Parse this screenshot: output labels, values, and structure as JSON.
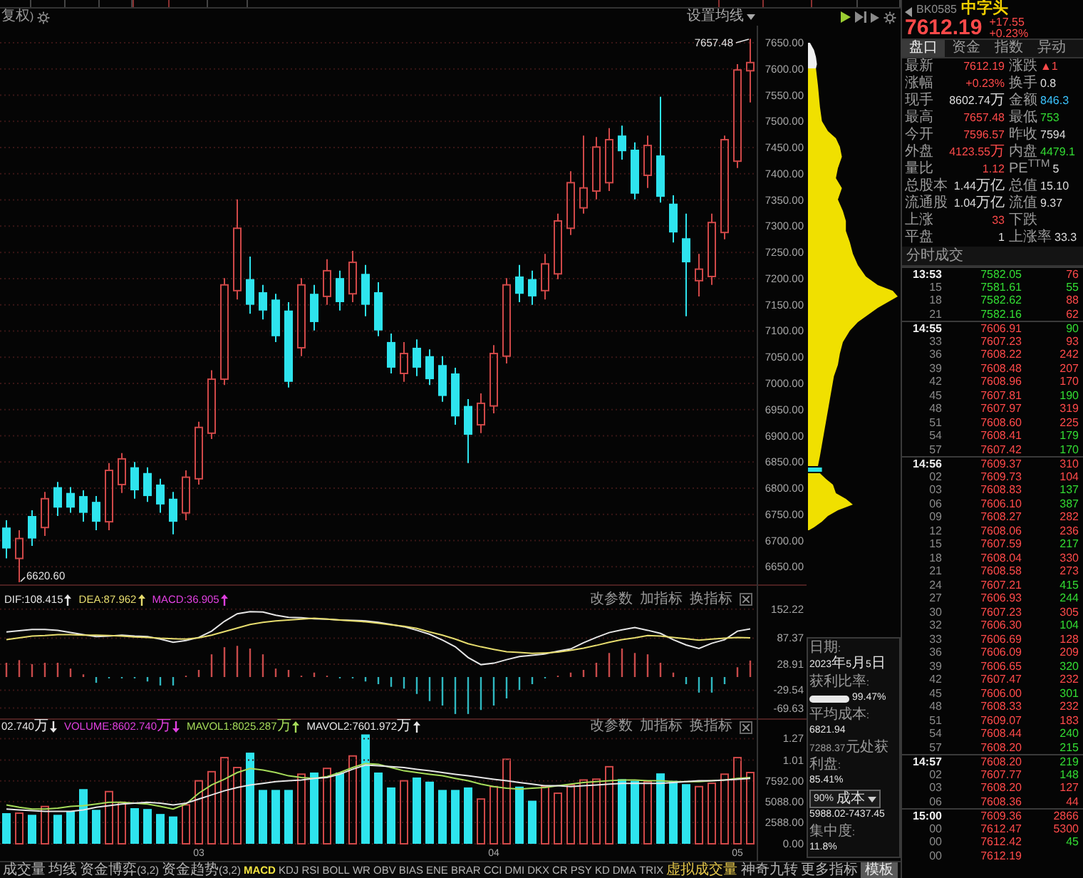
{
  "chart_header": {
    "left_label": "复权)",
    "ma_button": "设置均线"
  },
  "price_chart": {
    "high_label": "7657.48",
    "low_label": "6620.60",
    "chart_data": {
      "type": "candlestick",
      "grid": true,
      "ylim": [
        6616.5,
        7682.6
      ],
      "yticks": [
        {
          "value": 7650,
          "label": "7650.00"
        },
        {
          "value": 7600,
          "label": "7600.00"
        },
        {
          "value": 7550,
          "label": "7550.00"
        },
        {
          "value": 7500,
          "label": "7500.00"
        },
        {
          "value": 7450,
          "label": "7450.00"
        },
        {
          "value": 7400,
          "label": "7400.00"
        },
        {
          "value": 7350,
          "label": "7350.00"
        },
        {
          "value": 7300,
          "label": "7300.00"
        },
        {
          "value": 7250,
          "label": "7250.00"
        },
        {
          "value": 7200,
          "label": "7200.00"
        },
        {
          "value": 7150,
          "label": "7150.00"
        },
        {
          "value": 7100,
          "label": "7100.00"
        },
        {
          "value": 7050,
          "label": "7050.00"
        },
        {
          "value": 7000,
          "label": "7000.00"
        },
        {
          "value": 6950,
          "label": "6950.00"
        },
        {
          "value": 6900,
          "label": "6900.00"
        },
        {
          "value": 6850,
          "label": "6850.00"
        },
        {
          "value": 6800,
          "label": "6800.00"
        },
        {
          "value": 6750,
          "label": "6750.00"
        },
        {
          "value": 6700,
          "label": "6700.00"
        },
        {
          "value": 6650,
          "label": "6650.00"
        }
      ],
      "categories": [
        null,
        null,
        null,
        null,
        null,
        null,
        null,
        null,
        null,
        null,
        null,
        null,
        null,
        null,
        null,
        null,
        null,
        null,
        null,
        null,
        null,
        null,
        null,
        null,
        null,
        null,
        null,
        null,
        null,
        null,
        null,
        null,
        null,
        null,
        null,
        null,
        null,
        null,
        null,
        null,
        null,
        null,
        null,
        null,
        null,
        null,
        null,
        null,
        null,
        null,
        null,
        null,
        null,
        null,
        null,
        null,
        null,
        null,
        null
      ],
      "ohlc": [
        [
          6725,
          6739,
          6666,
          6685
        ],
        [
          6666,
          6720,
          6620.6,
          6704
        ],
        [
          6747,
          6758,
          6690,
          6704
        ],
        [
          6725,
          6793,
          6709,
          6780
        ],
        [
          6802,
          6812,
          6747,
          6763
        ],
        [
          6791,
          6802,
          6753,
          6763
        ],
        [
          6785,
          6796,
          6736,
          6753
        ],
        [
          6774,
          6785,
          6720,
          6736
        ],
        [
          6736,
          6848,
          6720,
          6834
        ],
        [
          6807,
          6867,
          6791,
          6856
        ],
        [
          6840,
          6850,
          6780,
          6796
        ],
        [
          6829,
          6840,
          6774,
          6785
        ],
        [
          6807,
          6818,
          6753,
          6769
        ],
        [
          6780,
          6793,
          6712,
          6736
        ],
        [
          6753,
          6834,
          6739,
          6821
        ],
        [
          6818,
          6927,
          6807,
          6916
        ],
        [
          6905,
          7025,
          6894,
          7008
        ],
        [
          7008,
          7201,
          6997,
          7188
        ],
        [
          7177,
          7351,
          7160,
          7296
        ],
        [
          7199,
          7242,
          7133,
          7150
        ],
        [
          7174,
          7188,
          7122,
          7139
        ],
        [
          7160,
          7171,
          7079,
          7090
        ],
        [
          7139,
          7155,
          6992,
          7003
        ],
        [
          7068,
          7201,
          7052,
          7188
        ],
        [
          7171,
          7188,
          7101,
          7117
        ],
        [
          7166,
          7237,
          7150,
          7215
        ],
        [
          7201,
          7215,
          7139,
          7155
        ],
        [
          7171,
          7253,
          7155,
          7231
        ],
        [
          7209,
          7226,
          7128,
          7150
        ],
        [
          7174,
          7193,
          7090,
          7101
        ],
        [
          7079,
          7095,
          7019,
          7030
        ],
        [
          7019,
          7079,
          7003,
          7057
        ],
        [
          7068,
          7084,
          7014,
          7030
        ],
        [
          7052,
          7065,
          6997,
          7008
        ],
        [
          7035,
          7052,
          6965,
          6976
        ],
        [
          7019,
          7030,
          6921,
          6937
        ],
        [
          6957,
          6970,
          6848,
          6902
        ],
        [
          6921,
          6981,
          6905,
          6962
        ],
        [
          6957,
          7073,
          6943,
          7057
        ],
        [
          7052,
          7201,
          7038,
          7188
        ],
        [
          7204,
          7226,
          7155,
          7171
        ],
        [
          7199,
          7215,
          7150,
          7166
        ],
        [
          7177,
          7247,
          7160,
          7228
        ],
        [
          7209,
          7324,
          7199,
          7310
        ],
        [
          7296,
          7405,
          7283,
          7383
        ],
        [
          7335,
          7473,
          7324,
          7373
        ],
        [
          7367,
          7470,
          7351,
          7451
        ],
        [
          7383,
          7487,
          7367,
          7465
        ],
        [
          7473,
          7492,
          7427,
          7443
        ],
        [
          7446,
          7460,
          7351,
          7362
        ],
        [
          7397,
          7473,
          7373,
          7454
        ],
        [
          7435,
          7547,
          7345,
          7356
        ],
        [
          7343,
          7359,
          7269,
          7288
        ],
        [
          7277,
          7324,
          7128,
          7231
        ],
        [
          7196,
          7247,
          7166,
          7218
        ],
        [
          7204,
          7324,
          7188,
          7307
        ],
        [
          7288,
          7473,
          7275,
          7465
        ],
        [
          7424,
          7609,
          7411,
          7598
        ],
        [
          7596.57,
          7657.48,
          7536,
          7612.19
        ]
      ]
    }
  },
  "macd_panel": {
    "readouts": [
      {
        "text": "DIF:108.415",
        "rising": true,
        "color": "#e6e6e6"
      },
      {
        "text": "DEA:87.962",
        "rising": true,
        "color": "#e6dc6e"
      },
      {
        "text": "MACD:36.905",
        "rising": true,
        "color": "#e040e0"
      }
    ],
    "buttons": [
      "改参数",
      "加指标",
      "换指标"
    ],
    "chart_data": {
      "type": "line",
      "grid": true,
      "ylim": [
        -92.8,
        208
      ],
      "yticks": [
        152.22,
        87.37,
        28.91,
        -29.54,
        -69.63
      ],
      "categories": [
        null,
        null,
        null,
        null,
        null,
        null,
        null,
        null,
        null,
        null,
        null,
        null,
        null,
        null,
        null,
        null,
        null,
        null,
        null,
        null,
        null,
        null,
        null,
        null,
        null,
        null,
        null,
        null,
        null,
        null,
        null,
        null,
        null,
        null,
        null,
        null,
        null,
        null,
        null,
        null,
        null,
        null,
        null,
        null,
        null,
        null,
        null,
        null,
        null,
        null,
        null,
        null,
        null,
        null,
        null,
        null,
        null,
        null,
        null
      ],
      "series": [
        {
          "type": "bar",
          "values": [
            32,
            38,
            29,
            32,
            32,
            19,
            6,
            -13,
            -3,
            -3,
            -3,
            -10,
            -19,
            -19,
            3,
            16,
            51,
            67,
            70,
            64,
            51,
            19,
            16,
            3,
            10,
            3,
            -3,
            -3,
            -10,
            -16,
            -22,
            -26,
            -38,
            -54,
            -64,
            -83,
            -83,
            -74,
            -64,
            -48,
            -29,
            -16,
            -3,
            3,
            10,
            16,
            32,
            54,
            64,
            54,
            51,
            32,
            10,
            -16,
            -35,
            -35,
            -16,
            22,
            37
          ],
          "colors": [
            "#c84a4a",
            "#c84a4a",
            "#c84a4a",
            "#c84a4a",
            "#c84a4a",
            "#c84a4a",
            "#c84a4a",
            "#2fb8c0",
            "#2fb8c0",
            "#2fb8c0",
            "#2fb8c0",
            "#2fb8c0",
            "#2fb8c0",
            "#2fb8c0",
            "#c84a4a",
            "#c84a4a",
            "#c84a4a",
            "#c84a4a",
            "#c84a4a",
            "#c84a4a",
            "#c84a4a",
            "#c84a4a",
            "#c84a4a",
            "#c84a4a",
            "#c84a4a",
            "#c84a4a",
            "#2fb8c0",
            "#2fb8c0",
            "#2fb8c0",
            "#2fb8c0",
            "#2fb8c0",
            "#2fb8c0",
            "#2fb8c0",
            "#2fb8c0",
            "#2fb8c0",
            "#2fb8c0",
            "#2fb8c0",
            "#2fb8c0",
            "#2fb8c0",
            "#2fb8c0",
            "#2fb8c0",
            "#2fb8c0",
            "#2fb8c0",
            "#c84a4a",
            "#c84a4a",
            "#c84a4a",
            "#c84a4a",
            "#c84a4a",
            "#c84a4a",
            "#c84a4a",
            "#c84a4a",
            "#c84a4a",
            "#c84a4a",
            "#2fb8c0",
            "#2fb8c0",
            "#2fb8c0",
            "#2fb8c0",
            "#c84a4a",
            "#c84a4a"
          ]
        },
        {
          "color": "#e6e6e6",
          "values": [
            101,
            104,
            107,
            107,
            105,
            100,
            95,
            91,
            92,
            94,
            92,
            91,
            85,
            78,
            82,
            89,
            103,
            125,
            142,
            147,
            146,
            139,
            134,
            133,
            131,
            130,
            128,
            127,
            126,
            123,
            118,
            113,
            105,
            96,
            83,
            68,
            44,
            28,
            31,
            39,
            46,
            49,
            52,
            58,
            63,
            77,
            89,
            100,
            106,
            111,
            105,
            98,
            84,
            72,
            64,
            76,
            84,
            103,
            108
          ]
        },
        {
          "color": "#e6dc6e",
          "values": [
            84,
            88,
            92,
            93,
            95,
            95,
            94,
            94,
            93,
            92,
            90,
            89,
            87,
            86,
            85,
            88,
            94,
            102,
            110,
            118,
            123,
            126,
            128,
            130,
            132,
            130,
            128,
            126,
            124,
            121,
            117,
            114,
            109,
            101,
            94,
            85,
            75,
            68,
            62,
            57,
            55,
            53,
            54,
            56,
            60,
            65,
            71,
            78,
            84,
            88,
            93,
            92,
            89,
            86,
            83,
            85,
            87,
            89,
            88
          ]
        }
      ]
    }
  },
  "volume_panel": {
    "readouts": [
      {
        "text": "02.740万",
        "rising": false,
        "color": "#e6e6e6"
      },
      {
        "text": "VOLUME:8602.740万",
        "rising": false,
        "color": "#e040e0"
      },
      {
        "text": "MAVOL1:8025.287万",
        "rising": true,
        "color": "#a6dc5a"
      },
      {
        "text": "MAVOL2:7601.972万",
        "rising": true,
        "color": "#e6e6e6"
      }
    ],
    "buttons": [
      "改参数",
      "加指标",
      "换指标"
    ],
    "upper_axis_labels": [
      "1.27",
      "1.01"
    ],
    "chart_data": {
      "type": "bar",
      "grid": true,
      "ylim": [
        -2064,
        15136
      ],
      "yticks": [
        {
          "value": 7592,
          "label": "7592.00"
        },
        {
          "value": 5088,
          "label": "5088.00"
        },
        {
          "value": 2588,
          "label": "2588.00"
        },
        {
          "value": 0,
          "label": "0.00"
        }
      ],
      "categories": [
        null,
        null,
        null,
        null,
        null,
        null,
        null,
        null,
        null,
        null,
        null,
        null,
        null,
        null,
        null,
        "03",
        null,
        null,
        null,
        null,
        null,
        null,
        null,
        null,
        null,
        null,
        null,
        null,
        null,
        null,
        null,
        null,
        null,
        null,
        null,
        null,
        null,
        null,
        "04",
        null,
        null,
        null,
        null,
        null,
        null,
        null,
        null,
        null,
        null,
        null,
        null,
        null,
        null,
        null,
        null,
        null,
        null,
        "05",
        null
      ],
      "series": [
        {
          "values": [
            3700,
            3700,
            3500,
            4500,
            3500,
            3900,
            6600,
            4100,
            6300,
            5000,
            4300,
            4200,
            3600,
            3300,
            4700,
            7600,
            8700,
            10400,
            9200,
            11000,
            6500,
            6500,
            6500,
            8400,
            8600,
            9100,
            8600,
            10600,
            13200,
            8600,
            6800,
            7600,
            8000,
            7500,
            6500,
            6500,
            6800,
            5400,
            6900,
            10200,
            6900,
            5200,
            6900,
            6100,
            7100,
            7700,
            7800,
            9300,
            7800,
            7600,
            7500,
            8500,
            7600,
            7200,
            6900,
            7300,
            8400,
            10400,
            8600
          ],
          "colors": [
            "#2ee4ee",
            "#d04848",
            "#2ee4ee",
            "#d04848",
            "#2ee4ee",
            "#2ee4ee",
            "#2ee4ee",
            "#2ee4ee",
            "#d04848",
            "#d04848",
            "#2ee4ee",
            "#2ee4ee",
            "#2ee4ee",
            "#2ee4ee",
            "#d04848",
            "#d04848",
            "#d04848",
            "#d04848",
            "#d04848",
            "#2ee4ee",
            "#2ee4ee",
            "#2ee4ee",
            "#2ee4ee",
            "#d04848",
            "#2ee4ee",
            "#d04848",
            "#2ee4ee",
            "#d04848",
            "#2ee4ee",
            "#2ee4ee",
            "#2ee4ee",
            "#d04848",
            "#2ee4ee",
            "#2ee4ee",
            "#2ee4ee",
            "#2ee4ee",
            "#2ee4ee",
            "#d04848",
            "#d04848",
            "#d04848",
            "#2ee4ee",
            "#2ee4ee",
            "#d04848",
            "#d04848",
            "#d04848",
            "#d04848",
            "#d04848",
            "#d04848",
            "#2ee4ee",
            "#2ee4ee",
            "#d04848",
            "#2ee4ee",
            "#2ee4ee",
            "#2ee4ee",
            "#d04848",
            "#d04848",
            "#d04848",
            "#d04848",
            "#d04848"
          ]
        },
        {
          "type": "line",
          "color": "#a6dc5a",
          "values": [
            4700,
            4400,
            4200,
            4200,
            4300,
            4500,
            4600,
            4800,
            5000,
            5000,
            4900,
            4800,
            4500,
            4200,
            4800,
            6100,
            7100,
            7800,
            8600,
            9100,
            8900,
            8600,
            8200,
            8000,
            7900,
            8100,
            8600,
            9200,
            9700,
            9600,
            9200,
            8800,
            8600,
            8400,
            8200,
            7900,
            7600,
            7200,
            6900,
            6700,
            6600,
            6700,
            6800,
            7000,
            7200,
            7400,
            7500,
            7600,
            7700,
            7700,
            7600,
            7600,
            7500,
            7500,
            7500,
            7600,
            7700,
            7900,
            8000
          ]
        },
        {
          "type": "line",
          "color": "#e6e6e6",
          "values": [
            4200,
            4100,
            4000,
            3900,
            3900,
            3900,
            4100,
            4400,
            4600,
            4800,
            4900,
            5000,
            4900,
            4700,
            4900,
            5400,
            5900,
            6400,
            6800,
            7100,
            7300,
            7500,
            7600,
            7700,
            7900,
            8000,
            8400,
            9000,
            9500,
            9400,
            9300,
            9200,
            9000,
            8800,
            8600,
            8400,
            8200,
            8000,
            7800,
            7600,
            7400,
            7200,
            7000,
            7000,
            6900,
            7000,
            7100,
            7200,
            7300,
            7300,
            7300,
            7300,
            7400,
            7500,
            7600,
            7600,
            7700,
            7800,
            7900
          ]
        }
      ]
    }
  },
  "profile_info": {
    "rows": [
      {
        "kind": "text",
        "label": "日期:",
        "value": "2023年5月5日"
      },
      {
        "kind": "meter",
        "label": "获利比率:",
        "level": 0.9947,
        "value": "99.47%"
      },
      {
        "kind": "text",
        "label": "平均成本:",
        "value": "6821.94"
      },
      {
        "kind": "text",
        "label": "7288.37元处获利盘:",
        "value": "85.41%"
      },
      {
        "kind": "select",
        "label": "90%成本",
        "value": "5988.02-7437.45"
      },
      {
        "kind": "text",
        "label": "集中度:",
        "value": "11.8%"
      }
    ]
  },
  "indicator_tabs": [
    {
      "label": "成交量",
      "kind": "indicator",
      "selected": false
    },
    {
      "label": "均线",
      "kind": "indicator",
      "selected": false
    },
    {
      "label": "资金博弈(3,2)",
      "kind": "indicator",
      "selected": false
    },
    {
      "label": "资金趋势(3,2)",
      "kind": "indicator",
      "selected": false
    },
    {
      "label": "MACD",
      "kind": "indicator",
      "selected": true
    },
    {
      "label": "KDJ",
      "kind": "indicator",
      "selected": false
    },
    {
      "label": "RSI",
      "kind": "indicator",
      "selected": false
    },
    {
      "label": "BOLL",
      "kind": "indicator",
      "selected": false
    },
    {
      "label": "WR",
      "kind": "indicator",
      "selected": false
    },
    {
      "label": "OBV",
      "kind": "indicator",
      "selected": false
    },
    {
      "label": "BIAS",
      "kind": "indicator",
      "selected": false
    },
    {
      "label": "ENE",
      "kind": "indicator",
      "selected": false
    },
    {
      "label": "BRAR",
      "kind": "indicator",
      "selected": false
    },
    {
      "label": "CCI",
      "kind": "indicator",
      "selected": false
    },
    {
      "label": "DMI",
      "kind": "indicator",
      "selected": false
    },
    {
      "label": "DKX",
      "kind": "indicator",
      "selected": false
    },
    {
      "label": "CR",
      "kind": "indicator",
      "selected": false
    },
    {
      "label": "PSY",
      "kind": "indicator",
      "selected": false
    },
    {
      "label": "KD",
      "kind": "indicator",
      "selected": false
    },
    {
      "label": "DMA",
      "kind": "indicator",
      "selected": false
    },
    {
      "label": "TRIX",
      "kind": "indicator",
      "selected": false
    },
    {
      "label": "虚拟成交量",
      "kind": "featured",
      "selected": false
    },
    {
      "label": "神奇九转",
      "kind": "indicator",
      "selected": false
    },
    {
      "label": "更多指标",
      "kind": "indicator",
      "selected": false
    },
    {
      "label": "模板",
      "kind": "button",
      "selected": false
    }
  ],
  "quote_panel": {
    "header": {
      "code": "BK0585",
      "name": "中字头",
      "price": "7612.19",
      "change": "+17.55",
      "change_pct": "+0.23%",
      "rising": true
    },
    "tabs": [
      {
        "label": "盘口",
        "selected": true
      },
      {
        "label": "资金",
        "selected": false
      },
      {
        "label": "指数",
        "selected": false
      },
      {
        "label": "异动",
        "selected": false
      }
    ],
    "rows": [
      [
        {
          "label": "最新",
          "value": "7612.19",
          "color": "#ff4a4a"
        },
        {
          "label": "涨跌",
          "value": "▲1",
          "color": "#ff4a4a"
        }
      ],
      [
        {
          "label": "涨幅",
          "value": "+0.23%",
          "color": "#ff4a4a"
        },
        {
          "label": "换手",
          "value": "0.8",
          "color": "#dedede"
        }
      ],
      [
        {
          "label": "现手",
          "value": "8602.74万",
          "color": "#dedede"
        },
        {
          "label": "金额",
          "value": "846.3",
          "color": "#3cc4ff"
        }
      ],
      [
        {
          "label": "最高",
          "value": "7657.48",
          "color": "#ff4a4a"
        },
        {
          "label": "最低",
          "value": "753",
          "color": "#33dd33"
        }
      ],
      [
        {
          "label": "今开",
          "value": "7596.57",
          "color": "#ff4a4a"
        },
        {
          "label": "昨收",
          "value": "7594",
          "color": "#dedede"
        }
      ],
      [
        {
          "label": "外盘",
          "value": "4123.55万",
          "color": "#ff4a4a"
        },
        {
          "label": "内盘",
          "value": "4479.1",
          "color": "#33dd33"
        }
      ],
      [
        {
          "label": "量比",
          "value": "1.12",
          "color": "#ff4a4a"
        },
        {
          "label": "PE$^{TTM}$",
          "value": "5",
          "color": "#dedede"
        }
      ],
      [
        {
          "label": "总股本",
          "value": "1.44万亿",
          "color": "#dedede"
        },
        {
          "label": "总值",
          "value": "15.10",
          "color": "#dedede"
        }
      ],
      [
        {
          "label": "流通股",
          "value": "1.04万亿",
          "color": "#dedede"
        },
        {
          "label": "流值",
          "value": "9.37",
          "color": "#dedede"
        }
      ],
      [
        {
          "label": "上涨",
          "value": "33",
          "color": "#ff4a4a"
        },
        {
          "label": "下跌"
        }
      ],
      [
        {
          "label": "平盘",
          "value": "1",
          "color": "#dedede"
        },
        {
          "label": "上涨率",
          "value": "33.3",
          "color": "#dedede"
        }
      ]
    ],
    "trades_title": "分时成交",
    "trade_groups": [
      {
        "rows": [
          {
            "time": "13:53",
            "price": {
              "text": "7582.05",
              "color": "#33dd33"
            },
            "volume": {
              "text": "76",
              "color": "#ff4a4a"
            }
          },
          {
            "time": "15",
            "price": {
              "text": "7581.61",
              "color": "#33dd33"
            },
            "volume": {
              "text": "55",
              "color": "#33dd33"
            }
          },
          {
            "time": "18",
            "price": {
              "text": "7582.62",
              "color": "#33dd33"
            },
            "volume": {
              "text": "88",
              "color": "#ff4a4a"
            }
          },
          {
            "time": "21",
            "price": {
              "text": "7582.16",
              "color": "#33dd33"
            },
            "volume": {
              "text": "62",
              "color": "#ff4a4a"
            }
          }
        ]
      },
      {
        "rows": [
          {
            "time": "14:55",
            "price": {
              "text": "7606.91",
              "color": "#ff4a4a"
            },
            "volume": {
              "text": "90",
              "color": "#33dd33"
            }
          },
          {
            "time": "33",
            "price": {
              "text": "7607.23",
              "color": "#ff4a4a"
            },
            "volume": {
              "text": "93",
              "color": "#ff4a4a"
            }
          },
          {
            "time": "36",
            "price": {
              "text": "7608.22",
              "color": "#ff4a4a"
            },
            "volume": {
              "text": "242",
              "color": "#ff4a4a"
            }
          },
          {
            "time": "39",
            "price": {
              "text": "7608.48",
              "color": "#ff4a4a"
            },
            "volume": {
              "text": "207",
              "color": "#ff4a4a"
            }
          },
          {
            "time": "42",
            "price": {
              "text": "7608.96",
              "color": "#ff4a4a"
            },
            "volume": {
              "text": "170",
              "color": "#ff4a4a"
            }
          },
          {
            "time": "45",
            "price": {
              "text": "7607.81",
              "color": "#ff4a4a"
            },
            "volume": {
              "text": "190",
              "color": "#33dd33"
            }
          },
          {
            "time": "48",
            "price": {
              "text": "7607.97",
              "color": "#ff4a4a"
            },
            "volume": {
              "text": "319",
              "color": "#ff4a4a"
            }
          },
          {
            "time": "51",
            "price": {
              "text": "7608.60",
              "color": "#ff4a4a"
            },
            "volume": {
              "text": "225",
              "color": "#ff4a4a"
            }
          },
          {
            "time": "54",
            "price": {
              "text": "7608.41",
              "color": "#ff4a4a"
            },
            "volume": {
              "text": "179",
              "color": "#33dd33"
            }
          },
          {
            "time": "57",
            "price": {
              "text": "7607.42",
              "color": "#ff4a4a"
            },
            "volume": {
              "text": "170",
              "color": "#33dd33"
            }
          }
        ]
      },
      {
        "rows": [
          {
            "time": "14:56",
            "price": {
              "text": "7609.37",
              "color": "#ff4a4a"
            },
            "volume": {
              "text": "310",
              "color": "#ff4a4a"
            }
          },
          {
            "time": "02",
            "price": {
              "text": "7609.73",
              "color": "#ff4a4a"
            },
            "volume": {
              "text": "104",
              "color": "#ff4a4a"
            }
          },
          {
            "time": "03",
            "price": {
              "text": "7608.83",
              "color": "#ff4a4a"
            },
            "volume": {
              "text": "137",
              "color": "#33dd33"
            }
          },
          {
            "time": "06",
            "price": {
              "text": "7606.10",
              "color": "#ff4a4a"
            },
            "volume": {
              "text": "387",
              "color": "#33dd33"
            }
          },
          {
            "time": "09",
            "price": {
              "text": "7608.27",
              "color": "#ff4a4a"
            },
            "volume": {
              "text": "282",
              "color": "#ff4a4a"
            }
          },
          {
            "time": "12",
            "price": {
              "text": "7608.06",
              "color": "#ff4a4a"
            },
            "volume": {
              "text": "236",
              "color": "#ff4a4a"
            }
          },
          {
            "time": "15",
            "price": {
              "text": "7607.59",
              "color": "#ff4a4a"
            },
            "volume": {
              "text": "217",
              "color": "#33dd33"
            }
          },
          {
            "time": "18",
            "price": {
              "text": "7608.04",
              "color": "#ff4a4a"
            },
            "volume": {
              "text": "330",
              "color": "#ff4a4a"
            }
          },
          {
            "time": "21",
            "price": {
              "text": "7608.58",
              "color": "#ff4a4a"
            },
            "volume": {
              "text": "273",
              "color": "#ff4a4a"
            }
          },
          {
            "time": "24",
            "price": {
              "text": "7607.21",
              "color": "#ff4a4a"
            },
            "volume": {
              "text": "415",
              "color": "#33dd33"
            }
          },
          {
            "time": "27",
            "price": {
              "text": "7606.93",
              "color": "#ff4a4a"
            },
            "volume": {
              "text": "244",
              "color": "#33dd33"
            }
          },
          {
            "time": "30",
            "price": {
              "text": "7607.23",
              "color": "#ff4a4a"
            },
            "volume": {
              "text": "305",
              "color": "#ff4a4a"
            }
          },
          {
            "time": "32",
            "price": {
              "text": "7606.30",
              "color": "#ff4a4a"
            },
            "volume": {
              "text": "104",
              "color": "#33dd33"
            }
          },
          {
            "time": "33",
            "price": {
              "text": "7606.69",
              "color": "#ff4a4a"
            },
            "volume": {
              "text": "128",
              "color": "#ff4a4a"
            }
          },
          {
            "time": "36",
            "price": {
              "text": "7606.09",
              "color": "#ff4a4a"
            },
            "volume": {
              "text": "209",
              "color": "#ff4a4a"
            }
          },
          {
            "time": "39",
            "price": {
              "text": "7606.65",
              "color": "#ff4a4a"
            },
            "volume": {
              "text": "320",
              "color": "#33dd33"
            }
          },
          {
            "time": "42",
            "price": {
              "text": "7607.47",
              "color": "#ff4a4a"
            },
            "volume": {
              "text": "232",
              "color": "#ff4a4a"
            }
          },
          {
            "time": "45",
            "price": {
              "text": "7606.00",
              "color": "#ff4a4a"
            },
            "volume": {
              "text": "301",
              "color": "#33dd33"
            }
          },
          {
            "time": "48",
            "price": {
              "text": "7608.33",
              "color": "#ff4a4a"
            },
            "volume": {
              "text": "232",
              "color": "#ff4a4a"
            }
          },
          {
            "time": "51",
            "price": {
              "text": "7609.07",
              "color": "#ff4a4a"
            },
            "volume": {
              "text": "183",
              "color": "#ff4a4a"
            }
          },
          {
            "time": "54",
            "price": {
              "text": "7608.44",
              "color": "#ff4a4a"
            },
            "volume": {
              "text": "240",
              "color": "#33dd33"
            }
          },
          {
            "time": "57",
            "price": {
              "text": "7608.20",
              "color": "#ff4a4a"
            },
            "volume": {
              "text": "215",
              "color": "#33dd33"
            }
          }
        ]
      },
      {
        "rows": [
          {
            "time": "14:57",
            "price": {
              "text": "7608.20",
              "color": "#ff4a4a"
            },
            "volume": {
              "text": "219",
              "color": "#33dd33"
            }
          },
          {
            "time": "02",
            "price": {
              "text": "7607.77",
              "color": "#ff4a4a"
            },
            "volume": {
              "text": "148",
              "color": "#33dd33"
            }
          },
          {
            "time": "03",
            "price": {
              "text": "7608.20",
              "color": "#ff4a4a"
            },
            "volume": {
              "text": "127",
              "color": "#ff4a4a"
            }
          },
          {
            "time": "06",
            "price": {
              "text": "7608.36",
              "color": "#ff4a4a"
            },
            "volume": {
              "text": "44",
              "color": "#ff4a4a"
            }
          }
        ]
      },
      {
        "rows": [
          {
            "time": "15:00",
            "price": {
              "text": "7609.36",
              "color": "#ff4a4a"
            },
            "volume": {
              "text": "2866",
              "color": "#ff4a4a"
            }
          },
          {
            "time": "00",
            "price": {
              "text": "7612.47",
              "color": "#ff4a4a"
            },
            "volume": {
              "text": "5300",
              "color": "#ff4a4a"
            }
          },
          {
            "time": "00",
            "price": {
              "text": "7612.42",
              "color": "#ff4a4a"
            },
            "volume": {
              "text": "45",
              "color": "#33dd33"
            }
          },
          {
            "time": "00",
            "price": {
              "text": "7612.19",
              "color": "#ff4a4a"
            }
          }
        ]
      }
    ]
  }
}
